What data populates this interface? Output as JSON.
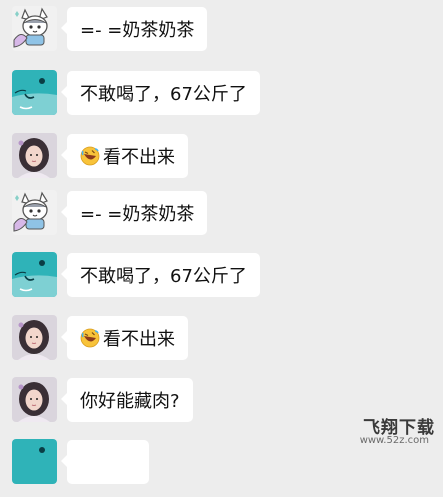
{
  "messages": [
    {
      "sender": "cartoon-kid",
      "text": "=- =奶茶奶茶",
      "emoji": ""
    },
    {
      "sender": "blue-bird",
      "text": "不敢喝了，67公斤了",
      "emoji": ""
    },
    {
      "sender": "girl",
      "text": "看不出来",
      "emoji": "rolling-laughing-emoji"
    },
    {
      "sender": "cartoon-kid",
      "text": "=- =奶茶奶茶",
      "emoji": ""
    },
    {
      "sender": "blue-bird",
      "text": "不敢喝了，67公斤了",
      "emoji": ""
    },
    {
      "sender": "girl",
      "text": "看不出来",
      "emoji": "rolling-laughing-emoji"
    },
    {
      "sender": "girl",
      "text": "你好能藏肉?",
      "emoji": ""
    },
    {
      "sender": "blue-bird",
      "text": "",
      "emoji": ""
    }
  ],
  "watermark": {
    "title": "飞翔下载",
    "url": "www.52z.com"
  },
  "colors": {
    "background": "#ededed",
    "bubble": "#ffffff",
    "bird": "#2fb3b8"
  }
}
